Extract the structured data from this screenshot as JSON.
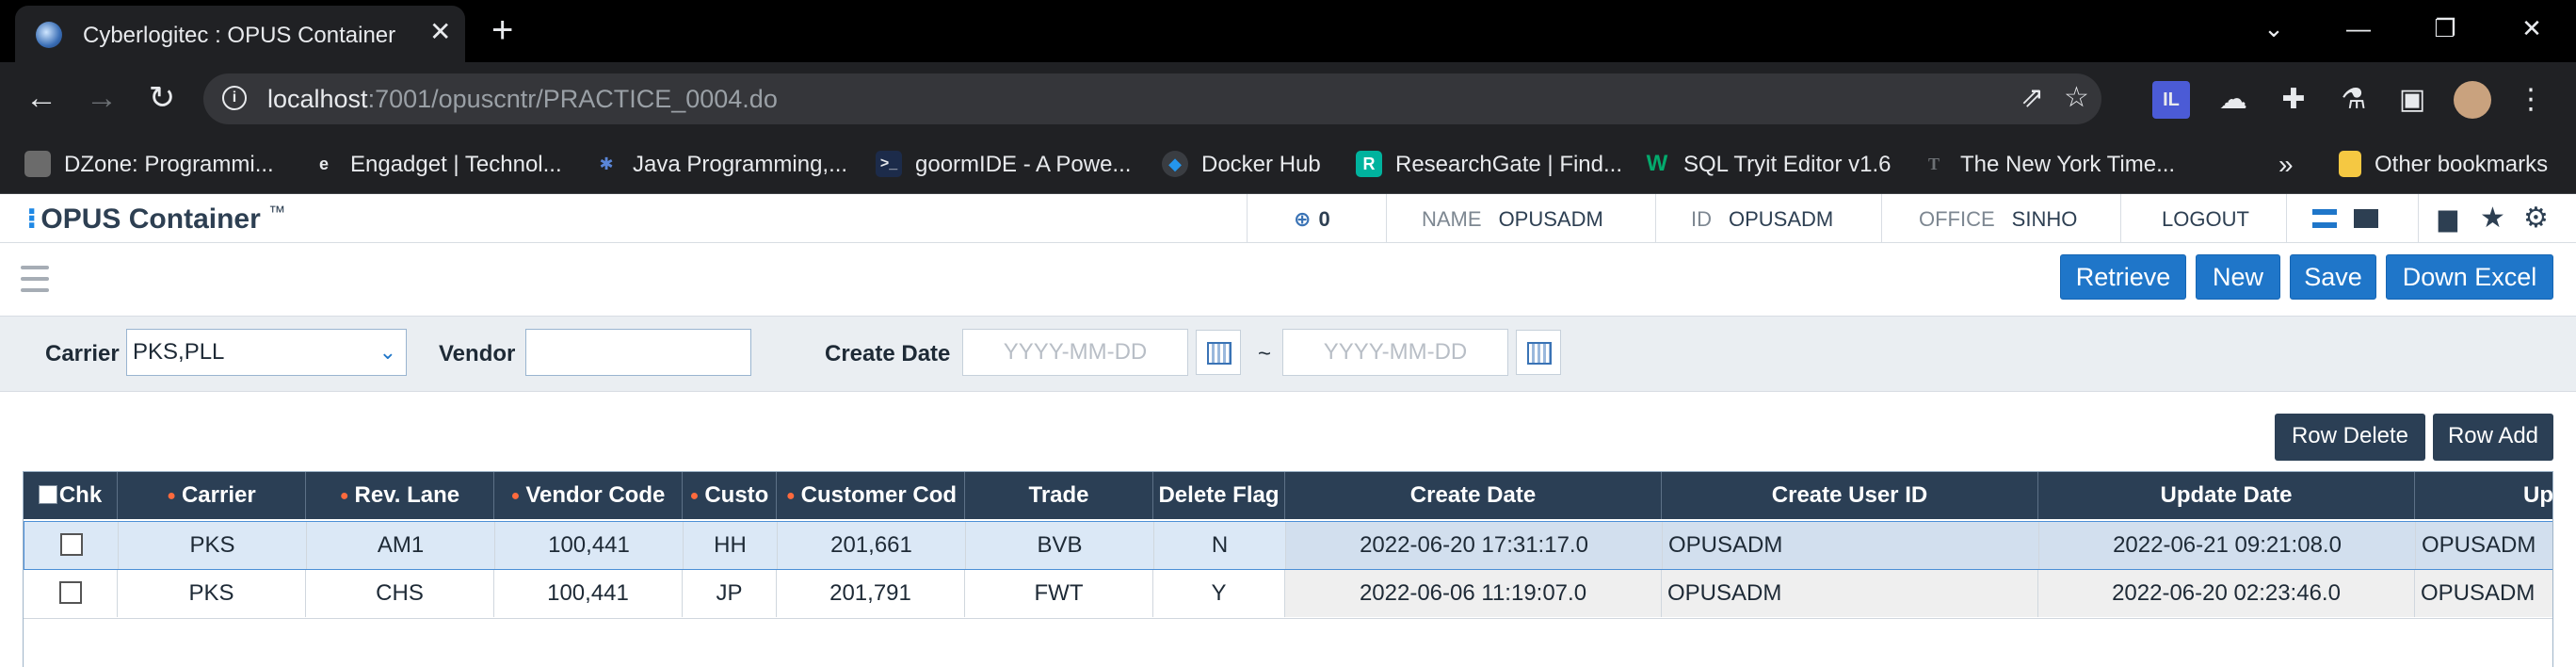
{
  "browser": {
    "tab_title": "Cyberlogitec : OPUS Container",
    "tab_close": "✕",
    "new_tab": "+",
    "url_host": "localhost",
    "url_path": ":7001/opuscntr/PRACTICE_0004.do",
    "bookmarks": [
      {
        "label": "DZone: Programmi...",
        "icon": "dzone-icon"
      },
      {
        "label": "Engadget | Technol...",
        "icon": "engadget-icon"
      },
      {
        "label": "Java Programming,...",
        "icon": "java-icon"
      },
      {
        "label": "goormIDE - A Powe...",
        "icon": "goorm-icon"
      },
      {
        "label": "Docker Hub",
        "icon": "docker-icon"
      },
      {
        "label": "ResearchGate | Find...",
        "icon": "researchgate-icon"
      },
      {
        "label": "SQL Tryit Editor v1.6",
        "icon": "w3schools-icon"
      },
      {
        "label": "The New York Time...",
        "icon": "nyt-icon"
      }
    ],
    "more_bookmarks": "»",
    "other_bookmarks": "Other bookmarks"
  },
  "app": {
    "logo_text": "OPUS Container",
    "logo_tm": "™",
    "notify_count": "0",
    "name_label": "NAME",
    "name_value": "OPUSADM",
    "id_label": "ID",
    "id_value": "OPUSADM",
    "office_label": "OFFICE",
    "office_value": "SINHO",
    "logout": "LOGOUT"
  },
  "buttons": {
    "retrieve": "Retrieve",
    "new": "New",
    "save": "Save",
    "down_excel": "Down Excel",
    "row_delete": "Row Delete",
    "row_add": "Row Add"
  },
  "search": {
    "carrier_label": "Carrier",
    "carrier_value": "PKS,PLL",
    "vendor_label": "Vendor",
    "vendor_value": "",
    "create_date_label": "Create Date",
    "date_from_placeholder": "YYYY-MM-DD",
    "date_to_placeholder": "YYYY-MM-DD",
    "range_sep": "~"
  },
  "grid": {
    "headers": {
      "chk": "Chk",
      "carrier": "Carrier",
      "rev_lane": "Rev. Lane",
      "vendor_code": "Vendor Code",
      "customer": "Custo",
      "customer_code": "Customer Cod",
      "trade": "Trade",
      "delete_flag": "Delete Flag",
      "create_date": "Create Date",
      "create_user_id": "Create User ID",
      "update_date": "Update Date",
      "update_user": "Up"
    },
    "rows": [
      {
        "carrier": "PKS",
        "rev_lane": "AM1",
        "vendor_code": "100,441",
        "customer": "HH",
        "customer_code": "201,661",
        "trade": "BVB",
        "delete_flag": "N",
        "create_date": "2022-06-20 17:31:17.0",
        "create_user_id": "OPUSADM",
        "update_date": "2022-06-21 09:21:08.0",
        "update_user": "OPUSADM"
      },
      {
        "carrier": "PKS",
        "rev_lane": "CHS",
        "vendor_code": "100,441",
        "customer": "JP",
        "customer_code": "201,791",
        "trade": "FWT",
        "delete_flag": "Y",
        "create_date": "2022-06-06 11:19:07.0",
        "create_user_id": "OPUSADM",
        "update_date": "2022-06-20 02:23:46.0",
        "update_user": "OPUSADM"
      }
    ]
  }
}
